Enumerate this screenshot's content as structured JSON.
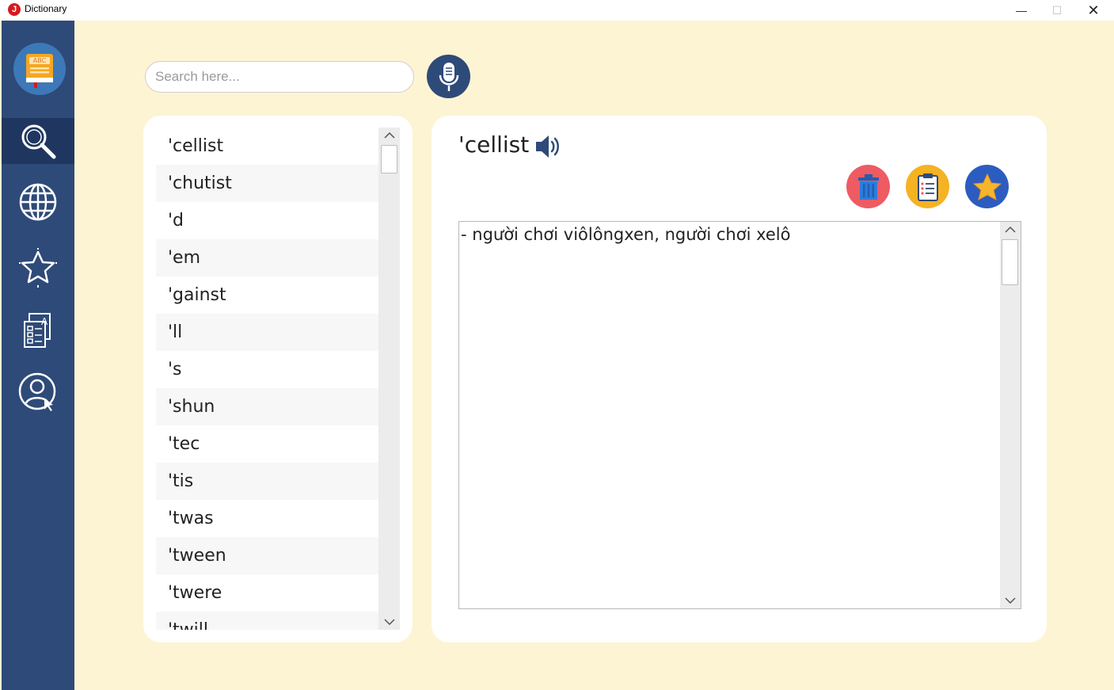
{
  "window": {
    "title": "Dictionary",
    "app_icon_letter": "J",
    "minimize": "—",
    "maximize": "☐",
    "close": "✕"
  },
  "sidebar": {
    "items": [
      {
        "name": "search",
        "icon": "search-icon",
        "active": true
      },
      {
        "name": "translate",
        "icon": "globe-icon",
        "active": false
      },
      {
        "name": "favorites",
        "icon": "star-icon",
        "active": false
      },
      {
        "name": "documents",
        "icon": "document-icon",
        "active": false
      },
      {
        "name": "account",
        "icon": "user-icon",
        "active": false
      }
    ]
  },
  "search": {
    "placeholder": "Search here...",
    "value": ""
  },
  "word_list": [
    "'cellist",
    "'chutist",
    "'d",
    "'em",
    "'gainst",
    "'ll",
    "'s",
    "'shun",
    "'tec",
    "'tis",
    "'twas",
    "'tween",
    "'twere",
    "'twill"
  ],
  "detail": {
    "word": "'cellist",
    "meaning": "- người chơi viôlôngxen, người chơi xelô"
  },
  "colors": {
    "background": "#fdf4d3",
    "sidebar": "#2e4a78",
    "delete": "#ee5b63",
    "edit": "#f5b223",
    "star": "#2d5cc0"
  }
}
